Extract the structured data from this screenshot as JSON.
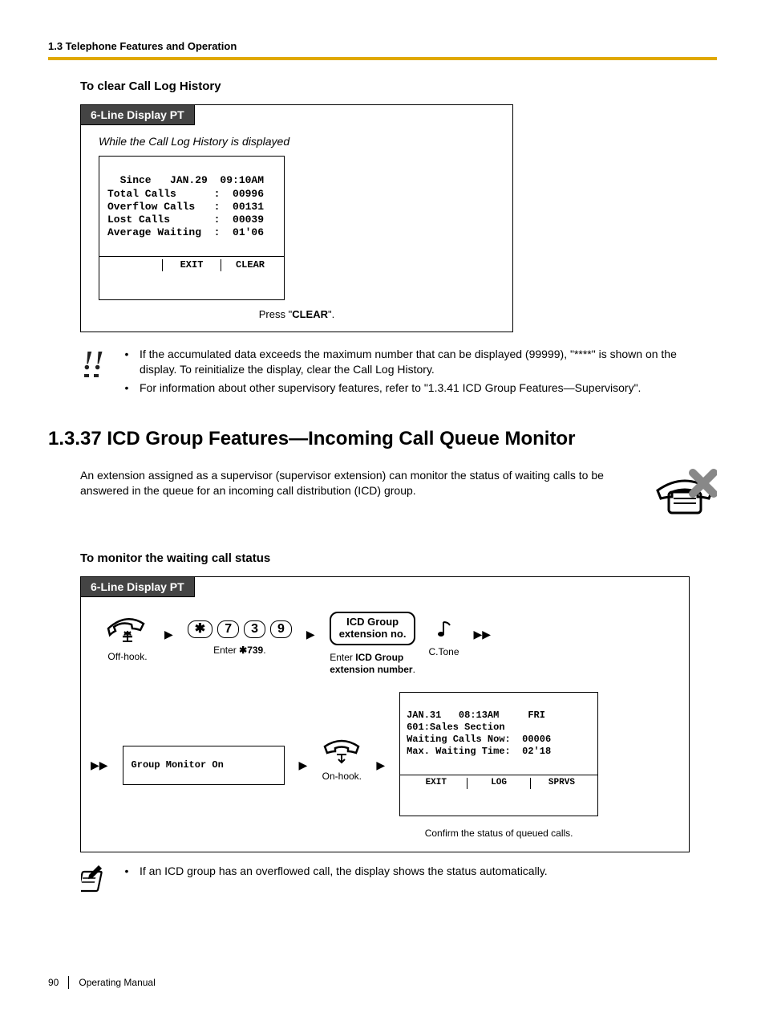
{
  "running_head": "1.3 Telephone Features and Operation",
  "sec1": {
    "heading": "To clear Call Log History",
    "tab": "6-Line Display PT",
    "condition": "While the Call Log History is displayed",
    "lcd": {
      "l1": "  Since   JAN.29  09:10AM",
      "l2": "Total Calls      :  00996",
      "l3": "Overflow Calls   :  00131",
      "l4": "Lost Calls       :  00039",
      "l5": "Average Waiting  :  01'06",
      "k_exit": "EXIT",
      "k_clear": "CLEAR"
    },
    "press_pre": "Press \"",
    "press_key": "CLEAR",
    "press_post": "\"."
  },
  "notes1": {
    "b1": "If the accumulated data exceeds the maximum number that can be displayed (99999), \"****\" is shown on the display. To reinitialize the display, clear the Call Log History.",
    "b2": "For information about other supervisory features, refer to \"1.3.41 ICD Group Features—Supervisory\"."
  },
  "title": "1.3.37  ICD Group Features—Incoming Call Queue Monitor",
  "intro": "An extension assigned as a supervisor (supervisor extension) can monitor the status of waiting calls to be answered in the queue for an incoming call distribution (ICD) group.",
  "sec2": {
    "heading": "To monitor the waiting call status",
    "tab": "6-Line Display PT",
    "steps": {
      "offhook": "Off-hook.",
      "k_star": "✱",
      "k7": "7",
      "k3": "3",
      "k9": "9",
      "enter_pre": "Enter ",
      "enter_bold": "✱739",
      "enter_post": ".",
      "bubble_l1": "ICD Group",
      "bubble_l2": "extension no.",
      "ctone": "C.Tone",
      "enter2_pre": "Enter ",
      "enter2_bold": "ICD Group",
      "enter2_line2": "extension number",
      "enter2_post": ".",
      "gmon": "Group Monitor On",
      "onhook": "On-hook.",
      "lcd2": {
        "l1": "JAN.31   08:13AM     FRI",
        "l2": "601:Sales Section",
        "l3": "Waiting Calls Now:  00006",
        "l4": "Max. Waiting Time:  02'18",
        "k_exit": "EXIT",
        "k_log": "LOG",
        "k_sprvs": "SPRVS"
      },
      "confirm": "Confirm the status of queued calls."
    }
  },
  "notes2": {
    "b1": "If an ICD group has an overflowed call, the display shows the status automatically."
  },
  "footer": {
    "page": "90",
    "manual": "Operating Manual"
  }
}
